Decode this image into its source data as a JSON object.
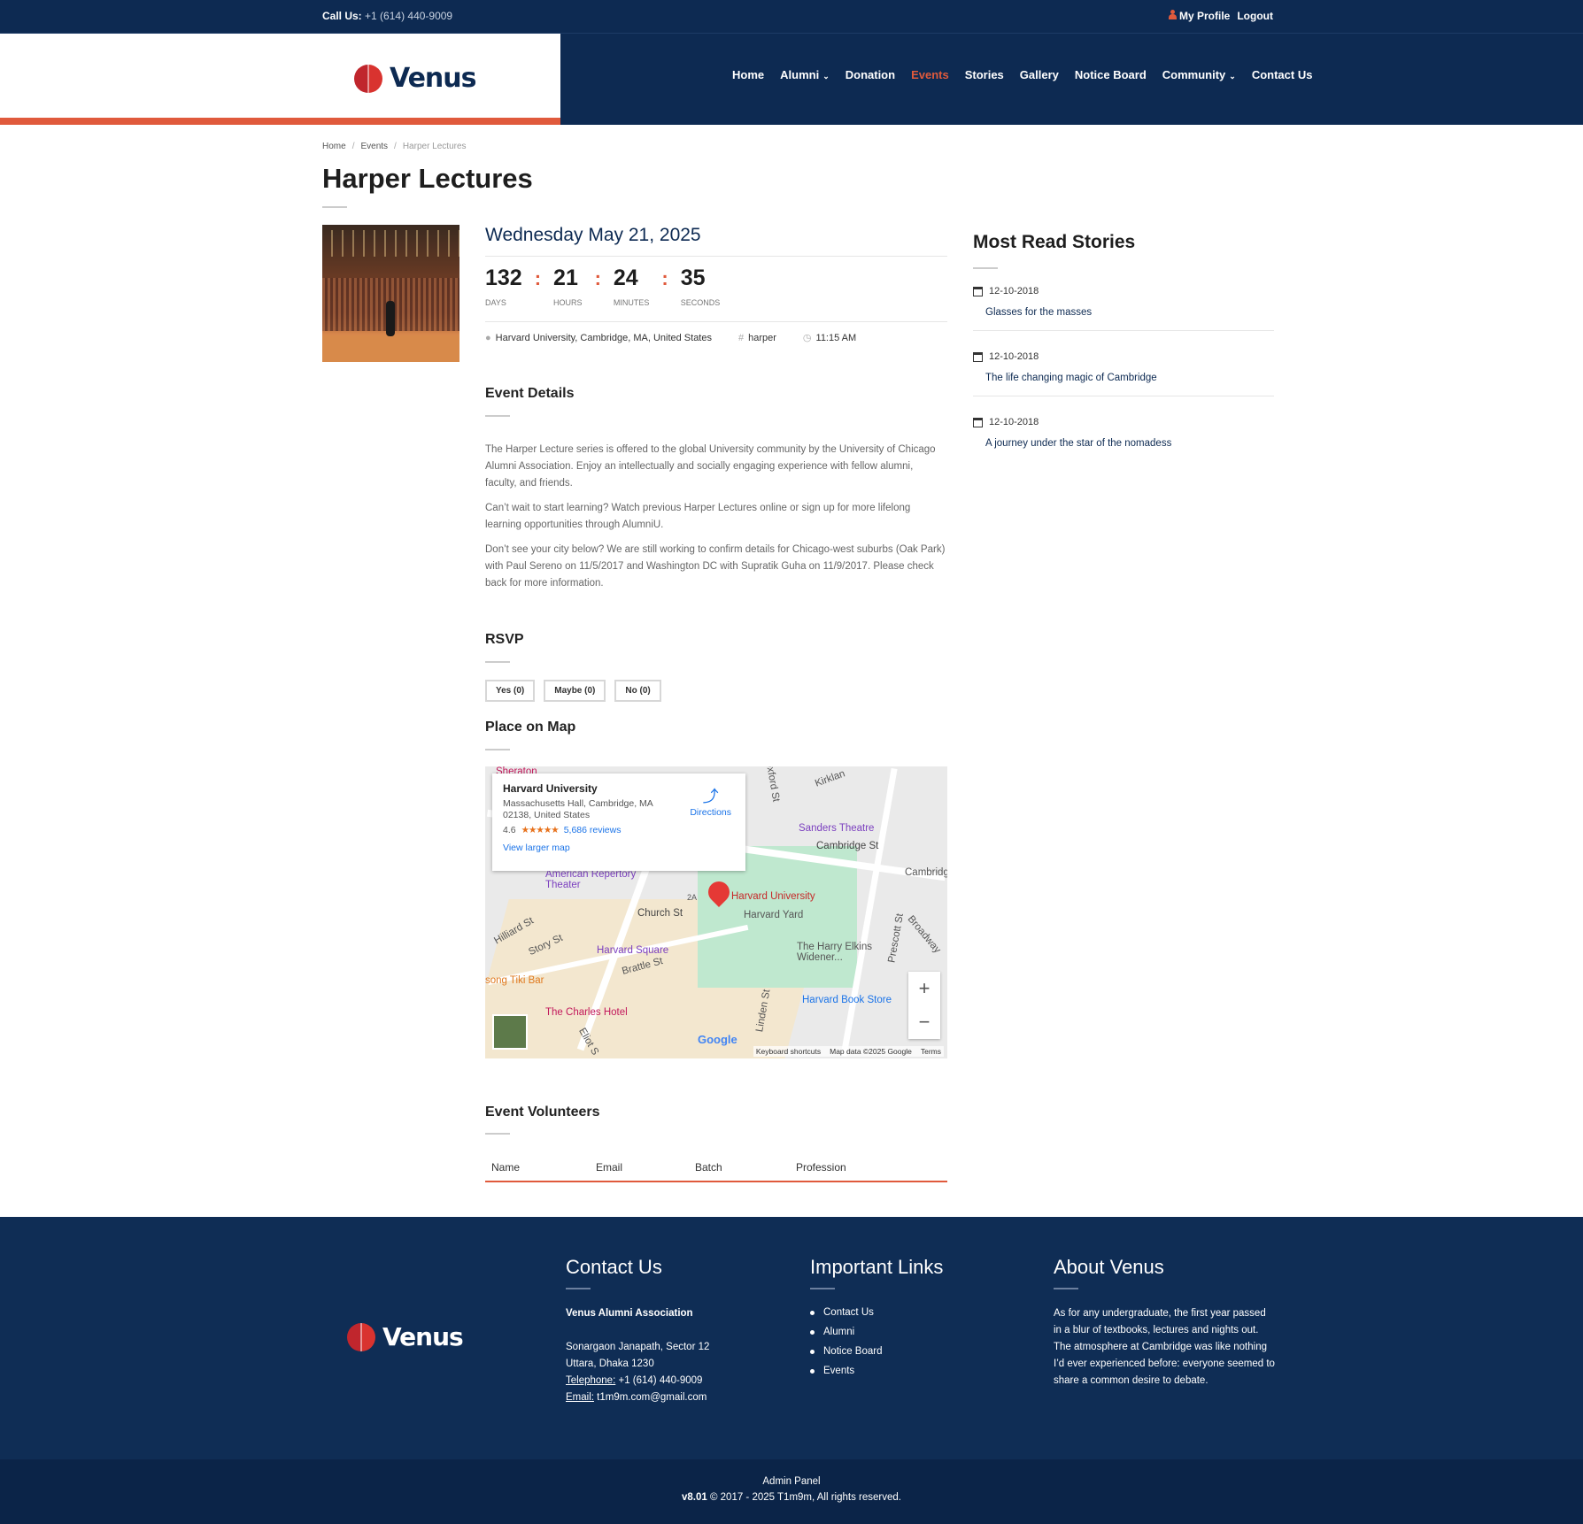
{
  "topbar": {
    "call_label": "Call Us:",
    "call_number": "+1 (614) 440-9009",
    "my_profile": "My Profile",
    "logout": "Logout"
  },
  "brand": {
    "name": "Venus"
  },
  "nav": {
    "items": [
      "Home",
      "Alumni",
      "Donation",
      "Events",
      "Stories",
      "Gallery",
      "Notice Board",
      "Community",
      "Contact Us"
    ],
    "active": "Events",
    "dropdowns": [
      "Alumni",
      "Community"
    ]
  },
  "breadcrumb": [
    "Home",
    "Events",
    "Harper Lectures"
  ],
  "page": {
    "title": "Harper Lectures"
  },
  "event": {
    "date": "Wednesday May 21, 2025",
    "countdown": {
      "days": "132",
      "days_label": "DAYS",
      "hours": "21",
      "hours_label": "HOURS",
      "minutes": "24",
      "minutes_label": "MINUTES",
      "seconds": "35",
      "seconds_label": "SECONDS"
    },
    "location": "Harvard University, Cambridge, MA, United States",
    "tag": "harper",
    "time": "11:15 AM",
    "details_heading": "Event Details",
    "paragraphs": [
      "The Harper Lecture series is offered to the global University community by the University of Chicago Alumni Association. Enjoy an intellectually and socially engaging experience with fellow alumni, faculty, and friends.",
      "Can’t wait to start learning? Watch previous Harper Lectures online or sign up for more lifelong learning opportunities through AlumniU.",
      "Don’t see your city below? We are still working to confirm details for Chicago-west suburbs (Oak Park) with Paul Sereno on 11/5/2017 and Washington DC with Supratik Guha on 11/9/2017. Please check back for more information."
    ],
    "rsvp_heading": "RSVP",
    "rsvp": {
      "yes": "Yes (0)",
      "maybe": "Maybe (0)",
      "no": "No (0)"
    },
    "map_heading": "Place on Map",
    "volunteers_heading": "Event Volunteers",
    "volunteer_columns": [
      "Name",
      "Email",
      "Batch",
      "Profession"
    ]
  },
  "map": {
    "place_name": "Harvard University",
    "address": "Massachusetts Hall, Cambridge, MA 02138, United States",
    "rating": "4.6",
    "stars": "★★★★★",
    "reviews": "5,686 reviews",
    "view_larger": "View larger map",
    "directions": "Directions",
    "labels": {
      "sheraton": "Sheraton",
      "sanders": "Sanders Theatre",
      "cambridge_st": "Cambridge St",
      "cambridge_la": "Cambridge & La",
      "kirkland": "Kirklan",
      "oxford": "Oxford St",
      "rep_theater": "American Repertory Theater",
      "harvard_univ": "Harvard University",
      "harvard_yard": "Harvard Yard",
      "church_st": "Church St",
      "hilliard": "Hilliard St",
      "story_st": "Story St",
      "harvard_square": "Harvard Square",
      "widener": "The Harry Elkins Widener...",
      "tiki": "song Tiki Bar",
      "brattle": "Brattle St",
      "book_store": "Harvard Book Store",
      "charles": "The Charles Hotel",
      "prescott": "Prescott St",
      "broadway": "Broadway",
      "linden": "Linden St",
      "eliot": "Eliot S",
      "route": "2A"
    },
    "zoom_in": "+",
    "zoom_out": "−",
    "google": "Google",
    "keyboard": "Keyboard shortcuts",
    "map_data": "Map data ©2025 Google",
    "terms": "Terms"
  },
  "sidebar": {
    "title": "Most Read Stories",
    "stories": [
      {
        "date": "12-10-2018",
        "title": "Glasses for the masses"
      },
      {
        "date": "12-10-2018",
        "title": "The life changing magic of Cambridge"
      },
      {
        "date": "12-10-2018",
        "title": "A journey under the star of the nomadess"
      }
    ]
  },
  "footer": {
    "contact": {
      "heading": "Contact Us",
      "org": "Venus Alumni Association",
      "address1": "Sonargaon Janapath, Sector 12",
      "address2": "Uttara, Dhaka 1230",
      "tel_label": "Telephone:",
      "tel": "+1 (614) 440-9009",
      "email_label": "Email:",
      "email": "t1m9m.com@gmail.com"
    },
    "links": {
      "heading": "Important Links",
      "items": [
        "Contact Us",
        "Alumni",
        "Notice Board",
        "Events"
      ]
    },
    "about": {
      "heading": "About Venus",
      "text": "As for any undergraduate, the first year passed in a blur of textbooks, lectures and nights out. The atmosphere at Cambridge was like nothing I’d ever experienced before: everyone seemed to share a common desire to debate."
    },
    "admin_panel": "Admin Panel",
    "version": "v8.01",
    "copyright": "© 2017 - 2025 T1m9m, All rights reserved."
  }
}
